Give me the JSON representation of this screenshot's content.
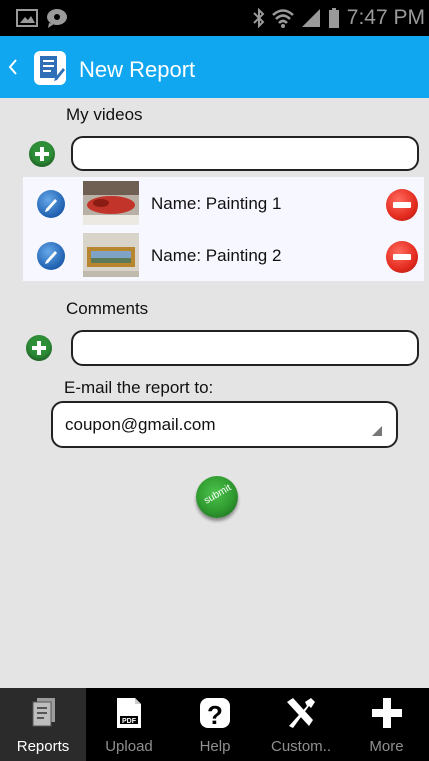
{
  "status_bar": {
    "time": "7:47 PM"
  },
  "action_bar": {
    "title": "New Report"
  },
  "videos": {
    "label": "My videos",
    "items": [
      {
        "name": "Name: Painting 1"
      },
      {
        "name": "Name: Painting 2"
      }
    ]
  },
  "comments": {
    "label": "Comments"
  },
  "email": {
    "label": "E-mail the report to:",
    "value": "coupon@gmail.com"
  },
  "submit": {
    "label": "submit"
  },
  "tabs": [
    {
      "label": "Reports",
      "icon": "reports-icon"
    },
    {
      "label": "Upload",
      "icon": "pdf-upload-icon"
    },
    {
      "label": "Help",
      "icon": "help-icon"
    },
    {
      "label": "Custom..",
      "icon": "tools-icon"
    },
    {
      "label": "More",
      "icon": "plus-icon"
    }
  ],
  "colors": {
    "accent": "#11a6f0",
    "add_green": "#2e8f38",
    "remove_red": "#e32b1e"
  }
}
